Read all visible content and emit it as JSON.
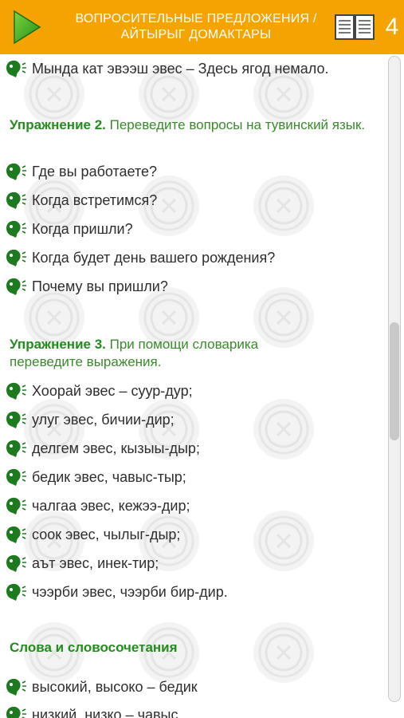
{
  "header": {
    "title_line1": "ВОПРОСИТЕЛЬНЫЕ ПРЕДЛОЖЕНИЯ /",
    "title_line2": "АЙТЫРЫГ ДОМАКТАРЫ",
    "page_number": "4",
    "play_icon": "play-icon",
    "book_icon": "book-icon"
  },
  "colors": {
    "header_bg": "#f5a300",
    "accent_green": "#248c1e",
    "text_dark": "#2e2e2e"
  },
  "content": {
    "top_items": [
      "Мында кат эвээш эвес – Здесь ягод немало."
    ],
    "exercise2": {
      "label": "Упражнение 2.",
      "text": "Переведите вопросы на тувинский язык.",
      "items": [
        "Где вы работаете?",
        "Когда встретимся?",
        "Когда пришли?",
        "Когда будет день вашего рождения?",
        "Почему вы пришли?"
      ]
    },
    "exercise3": {
      "label": "Упражнение 3.",
      "text_line1": "При помощи словарика",
      "text_line2": "переведите выражения.",
      "items": [
        "Хоорай эвес – суур-дур;",
        "улуг эвес, бичии-дир;",
        "делгем эвес, кызыы-дыр;",
        "бедик эвес, чавыс-тыр;",
        "чалгаа эвес, кежээ-дир;",
        "соок эвес, чылыг-дыр;",
        "аът эвес, инек-тир;",
        "чээрби эвес, чээрби бир-дир."
      ]
    },
    "words": {
      "title": "Слова и словосочетания",
      "items": [
        "высокий, высоко – бедик",
        "низкий, низко – чавыс"
      ]
    }
  }
}
